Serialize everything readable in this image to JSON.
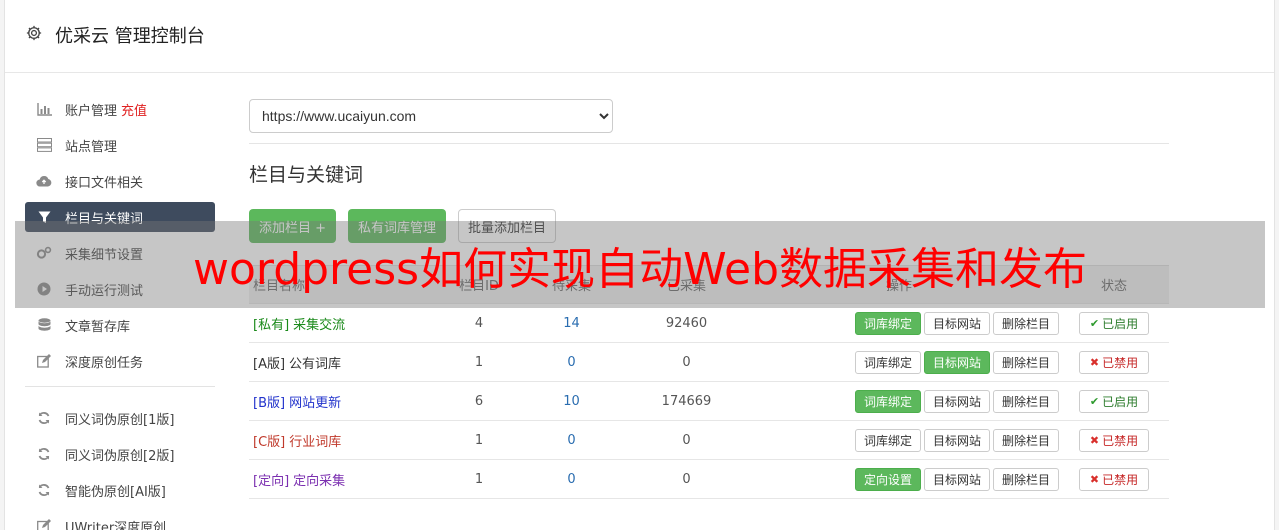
{
  "header": {
    "title": "优采云 管理控制台",
    "icon": "gear-icon"
  },
  "sidebar": {
    "items": [
      {
        "label": "账户管理",
        "extra": "充值",
        "icon": "bar-chart-icon"
      },
      {
        "label": "站点管理",
        "icon": "server-icon"
      },
      {
        "label": "接口文件相关",
        "icon": "cloud-upload-icon"
      },
      {
        "label": "栏目与关键词",
        "icon": "filter-icon",
        "active": true
      },
      {
        "label": "采集细节设置",
        "icon": "gears-icon"
      },
      {
        "label": "手动运行测试",
        "icon": "play-circle-icon"
      },
      {
        "label": "文章暂存库",
        "icon": "database-icon"
      },
      {
        "label": "深度原创任务",
        "icon": "edit-icon"
      }
    ],
    "items2": [
      {
        "label": "同义词伪原创[1版]",
        "icon": "refresh-icon"
      },
      {
        "label": "同义词伪原创[2版]",
        "icon": "refresh-icon"
      },
      {
        "label": "智能伪原创[AI版]",
        "icon": "refresh-icon"
      },
      {
        "label": "UWriter深度原创",
        "icon": "edit-icon"
      }
    ]
  },
  "main": {
    "site_select": "https://www.ucaiyun.com",
    "section_title": "栏目与关键词",
    "buttons": {
      "add": "添加栏目 +",
      "private_lib": "私有词库管理",
      "batch_add": "批量添加栏目"
    },
    "table": {
      "headers": [
        "栏目名称",
        "栏目ID",
        "待采集",
        "已采集",
        "操作",
        "状态"
      ],
      "rows": [
        {
          "tag": "[私有]",
          "name": "采集交流",
          "id": "4",
          "pending": "14",
          "collected": "92460",
          "op1": "词库绑定",
          "op2": "目标网站",
          "op3": "删除栏目",
          "op1_on": true,
          "op2_on": false,
          "status": "已启用",
          "enabled": true,
          "color": "#1a8a1a"
        },
        {
          "tag": "[A版]",
          "name": "公有词库",
          "id": "1",
          "pending": "0",
          "collected": "0",
          "op1": "词库绑定",
          "op2": "目标网站",
          "op3": "删除栏目",
          "op1_on": false,
          "op2_on": true,
          "status": "已禁用",
          "enabled": false,
          "color": "#333333"
        },
        {
          "tag": "[B版]",
          "name": "网站更新",
          "id": "6",
          "pending": "10",
          "collected": "174669",
          "op1": "词库绑定",
          "op2": "目标网站",
          "op3": "删除栏目",
          "op1_on": true,
          "op2_on": false,
          "status": "已启用",
          "enabled": true,
          "color": "#2233cc"
        },
        {
          "tag": "[C版]",
          "name": "行业词库",
          "id": "1",
          "pending": "0",
          "collected": "0",
          "op1": "词库绑定",
          "op2": "目标网站",
          "op3": "删除栏目",
          "op1_on": false,
          "op2_on": false,
          "status": "已禁用",
          "enabled": false,
          "color": "#c0392b"
        },
        {
          "tag": "[定向]",
          "name": "定向采集",
          "id": "1",
          "pending": "0",
          "collected": "0",
          "op1": "定向设置",
          "op2": "目标网站",
          "op3": "删除栏目",
          "op1_on": true,
          "op2_on": false,
          "status": "已禁用",
          "enabled": false,
          "color": "#7b2fb0"
        }
      ]
    }
  },
  "overlay": {
    "text": "wordpress如何实现自动Web数据采集和发布"
  }
}
